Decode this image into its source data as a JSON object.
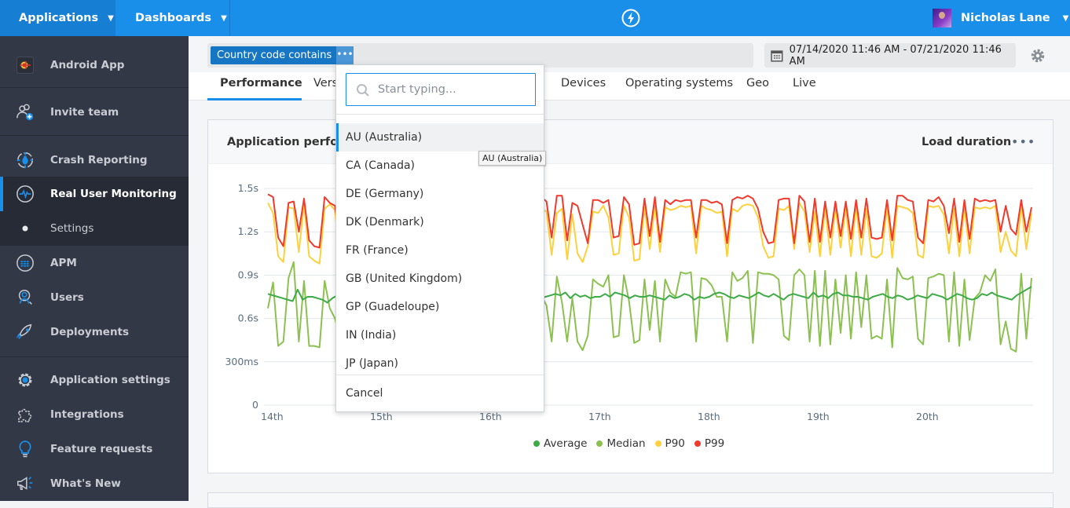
{
  "topbar": {
    "applications_label": "Applications",
    "dashboards_label": "Dashboards",
    "user_name": "Nicholas Lane"
  },
  "sidebar": {
    "app_name": "Android App",
    "items": [
      {
        "label": "Invite team",
        "icon": "invite-team-icon"
      },
      {
        "label": "Crash Reporting",
        "icon": "crash-reporting-icon"
      },
      {
        "label": "Real User Monitoring",
        "icon": "rum-pulse-icon",
        "active": true
      },
      {
        "label": "Settings",
        "icon": "bullet-icon",
        "sub": true
      },
      {
        "label": "APM",
        "icon": "apm-icon"
      },
      {
        "label": "Users",
        "icon": "users-icon"
      },
      {
        "label": "Deployments",
        "icon": "rocket-icon"
      },
      {
        "label": "Application settings",
        "icon": "gear-icon"
      },
      {
        "label": "Integrations",
        "icon": "puzzle-icon"
      },
      {
        "label": "Feature requests",
        "icon": "lightbulb-icon"
      },
      {
        "label": "What's New",
        "icon": "megaphone-icon"
      }
    ]
  },
  "filter": {
    "chip_label": "Country code contains",
    "chip_more": "•••",
    "date_range": "07/14/2020 11:46 AM - 07/21/2020 11:46 AM"
  },
  "tabs": [
    {
      "label": "Performance",
      "active": true
    },
    {
      "label": "Versions"
    },
    {
      "label": "Devices"
    },
    {
      "label": "Operating systems"
    },
    {
      "label": "Geo"
    },
    {
      "label": "Live"
    }
  ],
  "panel": {
    "title": "Application performance",
    "metric": "Load duration",
    "more": "•••"
  },
  "dropdown": {
    "search_placeholder": "Start typing...",
    "options": [
      "AU (Australia)",
      "CA (Canada)",
      "DE (Germany)",
      "DK (Denmark)",
      "FR (France)",
      "GB (United Kingdom)",
      "GP (Guadeloupe)",
      "IN (India)",
      "JP (Japan)"
    ],
    "highlighted": "AU (Australia)",
    "cancel_label": "Cancel",
    "tooltip": "AU (Australia)"
  },
  "chart_data": {
    "type": "line",
    "title": "Application performance",
    "ylabel": "Load duration",
    "xlabel": "",
    "x_ticks": [
      "14th",
      "15th",
      "16th",
      "17th",
      "18th",
      "19th",
      "20th"
    ],
    "y_ticks": [
      "0",
      "300ms",
      "0.6s",
      "0.9s",
      "1.2s",
      "1.5s"
    ],
    "ylim": [
      0,
      1.5
    ],
    "grid": true,
    "legend_position": "bottom",
    "x_unit": "hours since 14th 00:00",
    "series": [
      {
        "name": "Average",
        "color": "#3cab45",
        "values": [
          0.77,
          0.76,
          0.75,
          0.74,
          0.73,
          0.72,
          0.8,
          0.73,
          0.75,
          0.75,
          0.74,
          0.73,
          0.71,
          0.74,
          0.76,
          0.74,
          0.76,
          0.77,
          0.77,
          0.76,
          0.78,
          0.75,
          0.74,
          0.77,
          0.76,
          0.74,
          0.77,
          0.75,
          0.76,
          0.74,
          0.75,
          0.76,
          0.74,
          0.76,
          0.75,
          0.77,
          0.74,
          0.76,
          0.75,
          0.73,
          0.75,
          0.76,
          0.74,
          0.75,
          0.77,
          0.76,
          0.74,
          0.76,
          0.72,
          0.74,
          0.73,
          0.74,
          0.76,
          0.75,
          0.76,
          0.74,
          0.75,
          0.76,
          0.77,
          0.76,
          0.78,
          0.74,
          0.77,
          0.75,
          0.76,
          0.74,
          0.75,
          0.75,
          0.77,
          0.75,
          0.78,
          0.77,
          0.76,
          0.74,
          0.76,
          0.75,
          0.75,
          0.76,
          0.75,
          0.74,
          0.73,
          0.76,
          0.74,
          0.75,
          0.77,
          0.76,
          0.73,
          0.75,
          0.74,
          0.75,
          0.77,
          0.78,
          0.77,
          0.75,
          0.74,
          0.76,
          0.75,
          0.74,
          0.76,
          0.78,
          0.76,
          0.75,
          0.77,
          0.75,
          0.73,
          0.76,
          0.77,
          0.76,
          0.75,
          0.74,
          0.78,
          0.75,
          0.76,
          0.74,
          0.77,
          0.78,
          0.76,
          0.76,
          0.75,
          0.75,
          0.74,
          0.73,
          0.75,
          0.76,
          0.77,
          0.75,
          0.74,
          0.76,
          0.75,
          0.73,
          0.74,
          0.76,
          0.75,
          0.74,
          0.77,
          0.76,
          0.75,
          0.73,
          0.75,
          0.77,
          0.76,
          0.74,
          0.73,
          0.74,
          0.77,
          0.76,
          0.78,
          0.76,
          0.75,
          0.74,
          0.73,
          0.76,
          0.78,
          0.8,
          0.82
        ]
      },
      {
        "name": "Median",
        "color": "#7cc142",
        "values": [
          0.67,
          0.85,
          0.41,
          0.44,
          0.88,
          0.99,
          0.44,
          0.86,
          0.41,
          0.41,
          0.4,
          0.86,
          0.67,
          0.6,
          0.45,
          0.48,
          0.87,
          0.71,
          0.5,
          0.48,
          0.86,
          0.42,
          0.9,
          0.86,
          0.55,
          0.79,
          0.88,
          0.47,
          0.44,
          0.89,
          0.44,
          0.4,
          0.87,
          0.78,
          0.63,
          0.42,
          0.87,
          0.72,
          0.43,
          0.97,
          0.8,
          0.42,
          0.44,
          0.91,
          0.84,
          0.8,
          0.73,
          0.97,
          0.93,
          0.88,
          0.77,
          0.92,
          0.84,
          0.76,
          0.69,
          0.44,
          0.89,
          0.71,
          0.44,
          0.74,
          0.44,
          0.38,
          0.48,
          0.87,
          0.84,
          0.82,
          0.9,
          0.47,
          0.48,
          0.9,
          0.72,
          0.43,
          0.45,
          0.87,
          0.52,
          0.86,
          0.44,
          0.87,
          0.78,
          0.75,
          0.92,
          0.91,
          0.92,
          0.44,
          0.88,
          0.87,
          0.83,
          0.75,
          0.75,
          0.44,
          0.92,
          0.86,
          0.88,
          0.93,
          0.43,
          0.92,
          0.91,
          0.91,
          0.9,
          0.87,
          0.48,
          0.45,
          0.9,
          0.94,
          0.9,
          0.44,
          0.93,
          0.41,
          0.93,
          0.42,
          0.87,
          0.5,
          0.9,
          0.46,
          0.92,
          0.54,
          0.9,
          0.46,
          0.48,
          0.46,
          0.87,
          0.4,
          0.95,
          0.88,
          0.87,
          0.89,
          0.46,
          0.42,
          0.88,
          0.89,
          0.91,
          0.9,
          0.44,
          0.92,
          0.41,
          0.87,
          0.45,
          0.74,
          0.78,
          0.9,
          0.86,
          0.94,
          0.42,
          0.58,
          0.39,
          0.37,
          0.91,
          0.46,
          0.88
        ]
      },
      {
        "name": "P90",
        "color": "#fdd13d",
        "values": [
          1.4,
          1.33,
          1.03,
          0.99,
          1.37,
          1.36,
          1.06,
          1.39,
          1.03,
          1.0,
          0.98,
          1.36,
          1.39,
          1.35,
          1.01,
          1.04,
          1.33,
          1.34,
          1.03,
          1.01,
          1.36,
          1.06,
          1.35,
          1.37,
          1.02,
          1.33,
          1.38,
          1.0,
          1.01,
          1.37,
          1.33,
          1.05,
          1.38,
          1.3,
          1.02,
          0.98,
          1.35,
          1.33,
          1.04,
          1.36,
          1.26,
          0.95,
          1.01,
          1.38,
          1.35,
          1.26,
          1.11,
          1.42,
          1.35,
          1.37,
          1.34,
          1.37,
          1.33,
          1.36,
          1.34,
          1.04,
          1.33,
          1.36,
          1.01,
          1.32,
          1.05,
          0.99,
          1.1,
          1.34,
          1.33,
          1.38,
          1.3,
          1.04,
          1.05,
          1.38,
          1.3,
          1.0,
          1.01,
          1.37,
          1.08,
          1.38,
          1.06,
          1.37,
          1.35,
          1.36,
          1.38,
          1.37,
          1.38,
          1.05,
          1.38,
          1.36,
          1.35,
          1.33,
          1.34,
          1.03,
          1.36,
          1.34,
          1.38,
          1.39,
          1.38,
          1.3,
          1.1,
          1.02,
          1.03,
          1.36,
          1.35,
          1.38,
          1.08,
          1.4,
          1.34,
          1.06,
          1.34,
          1.03,
          1.36,
          1.04,
          1.37,
          1.09,
          1.36,
          1.03,
          1.38,
          1.04,
          1.36,
          1.03,
          1.02,
          1.05,
          1.37,
          1.02,
          1.38,
          1.37,
          1.36,
          1.33,
          1.04,
          1.02,
          1.38,
          1.37,
          1.38,
          1.32,
          1.05,
          1.36,
          1.03,
          1.37,
          1.05,
          1.37,
          1.36,
          1.37,
          1.36,
          1.38,
          1.06,
          1.2,
          1.07,
          1.03,
          1.38,
          1.08,
          1.33
        ]
      },
      {
        "name": "P99",
        "color": "#f03a2e",
        "values": [
          1.46,
          1.44,
          1.16,
          1.1,
          1.4,
          1.41,
          1.2,
          1.43,
          1.14,
          1.1,
          1.09,
          1.44,
          1.4,
          1.38,
          1.12,
          1.14,
          1.4,
          1.41,
          1.12,
          1.11,
          1.43,
          1.17,
          1.39,
          1.42,
          1.11,
          1.39,
          1.43,
          1.1,
          1.12,
          1.42,
          1.38,
          1.14,
          1.42,
          1.38,
          1.12,
          1.1,
          1.4,
          1.4,
          1.16,
          1.43,
          1.38,
          1.12,
          1.14,
          1.44,
          1.43,
          1.44,
          1.42,
          1.45,
          1.43,
          1.44,
          1.42,
          1.42,
          1.4,
          1.44,
          1.41,
          1.16,
          1.45,
          1.45,
          1.14,
          1.4,
          1.38,
          1.25,
          1.12,
          1.42,
          1.42,
          1.4,
          1.42,
          1.16,
          1.17,
          1.44,
          1.39,
          1.11,
          1.12,
          1.43,
          1.17,
          1.44,
          1.13,
          1.42,
          1.39,
          1.42,
          1.41,
          1.42,
          1.42,
          1.16,
          1.42,
          1.42,
          1.4,
          1.41,
          1.39,
          1.12,
          1.42,
          1.44,
          1.43,
          1.45,
          1.43,
          1.36,
          1.2,
          1.12,
          1.13,
          1.42,
          1.43,
          1.43,
          1.12,
          1.45,
          1.41,
          1.13,
          1.43,
          1.13,
          1.41,
          1.16,
          1.41,
          1.17,
          1.41,
          1.15,
          1.42,
          1.16,
          1.43,
          1.16,
          1.15,
          1.16,
          1.42,
          1.14,
          1.45,
          1.45,
          1.42,
          1.41,
          1.16,
          1.12,
          1.42,
          1.41,
          1.44,
          1.38,
          1.19,
          1.43,
          1.13,
          1.42,
          1.15,
          1.43,
          1.41,
          1.42,
          1.41,
          1.42,
          1.2,
          1.38,
          1.22,
          1.18,
          1.42,
          1.2,
          1.37
        ]
      }
    ]
  }
}
